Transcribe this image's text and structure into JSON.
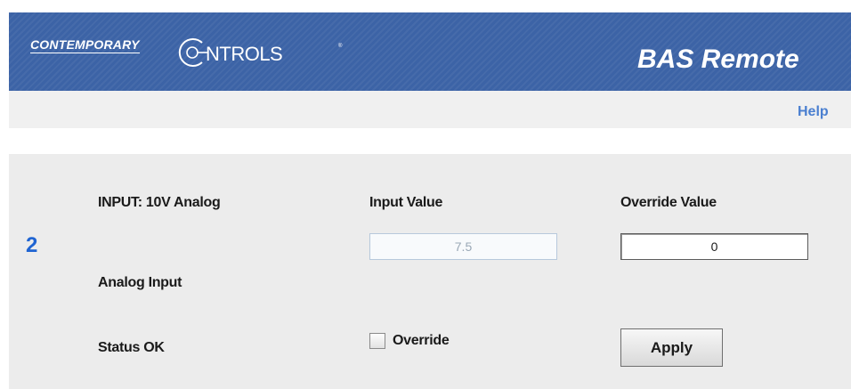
{
  "header": {
    "brand_small": "CONTEMPORARY",
    "brand_large": "NTROLS",
    "brand_trademark": "®",
    "product_title": "BAS Remote"
  },
  "nav": {
    "help_label": "Help"
  },
  "point": {
    "number": "2",
    "type_label": "INPUT: 10V Analog",
    "kind_label": "Analog Input",
    "status_label": "Status OK",
    "input_value_header": "Input Value",
    "input_value": "7.5",
    "override_value_header": "Override Value",
    "override_value": "0",
    "override_checkbox_label": "Override",
    "override_checked": false,
    "apply_label": "Apply"
  },
  "colors": {
    "header_bg": "#3c63a6",
    "accent_number": "#1f64d2",
    "help_link": "#4a7fd0",
    "panel_bg": "#ececec"
  }
}
